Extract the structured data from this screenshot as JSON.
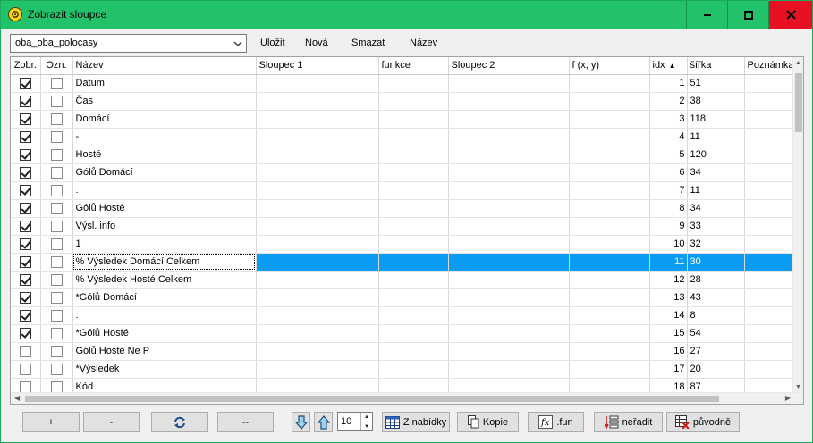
{
  "window": {
    "title": "Zobrazit sloupce",
    "minimize_glyph": "🗕",
    "maximize_glyph": "🗖",
    "close_glyph": "✕",
    "accent": "#21c26a",
    "close_color": "#e81123"
  },
  "toolbar": {
    "preset_value": "oba_oba_polocasy",
    "save_label": "Uložit",
    "new_label": "Nová",
    "delete_label": "Smazat",
    "name_label": "Název"
  },
  "grid": {
    "columns": [
      "Zobr.",
      "Ozn.",
      "Název",
      "Sloupec 1",
      "funkce",
      "Sloupec 2",
      "f (x, y)",
      "idx",
      "šířka",
      "Poznámka"
    ],
    "sort_column": "idx",
    "selected_index": 10,
    "selection_color": "#0c9cf2",
    "rows": [
      {
        "show": true,
        "mark": false,
        "name": "Datum",
        "idx": "1",
        "width": "51"
      },
      {
        "show": true,
        "mark": false,
        "name": "Čas",
        "idx": "2",
        "width": "38"
      },
      {
        "show": true,
        "mark": false,
        "name": "Domácí",
        "idx": "3",
        "width": "118"
      },
      {
        "show": true,
        "mark": false,
        "name": "-",
        "idx": "4",
        "width": "11"
      },
      {
        "show": true,
        "mark": false,
        "name": "Hosté",
        "idx": "5",
        "width": "120"
      },
      {
        "show": true,
        "mark": false,
        "name": "Gólů Domácí",
        "idx": "6",
        "width": "34"
      },
      {
        "show": true,
        "mark": false,
        "name": ":",
        "idx": "7",
        "width": "11"
      },
      {
        "show": true,
        "mark": false,
        "name": "Gólů Hosté",
        "idx": "8",
        "width": "34"
      },
      {
        "show": true,
        "mark": false,
        "name": "Výsl. info",
        "idx": "9",
        "width": "33"
      },
      {
        "show": true,
        "mark": false,
        "name": "1",
        "idx": "10",
        "width": "32"
      },
      {
        "show": true,
        "mark": false,
        "name": "% Výsledek Domácí Celkem",
        "idx": "11",
        "width": "30"
      },
      {
        "show": true,
        "mark": false,
        "name": "% Výsledek Hosté Celkem",
        "idx": "12",
        "width": "28"
      },
      {
        "show": true,
        "mark": false,
        "name": "*Gólů Domácí",
        "idx": "13",
        "width": "43"
      },
      {
        "show": true,
        "mark": false,
        "name": ":",
        "idx": "14",
        "width": "8"
      },
      {
        "show": true,
        "mark": false,
        "name": "*Gólů Hosté",
        "idx": "15",
        "width": "54"
      },
      {
        "show": false,
        "mark": false,
        "name": "Gólů Hosté Ne P",
        "idx": "16",
        "width": "27"
      },
      {
        "show": false,
        "mark": false,
        "name": "*Výsledek",
        "idx": "17",
        "width": "20"
      },
      {
        "show": false,
        "mark": false,
        "name": "Kód",
        "idx": "18",
        "width": "87"
      }
    ]
  },
  "bottom": {
    "add_label": "+",
    "remove_label": "-",
    "refresh_icon": "refresh-icon",
    "dashes_label": "--",
    "move_down_icon": "arrow-down-icon",
    "move_up_icon": "arrow-up-icon",
    "step_value": "10",
    "from_menu_label": "Z nabídky",
    "copy_label": "Kopie",
    "fun_label": ".fun",
    "unsort_label": "neřadit",
    "original_label": "původně"
  }
}
